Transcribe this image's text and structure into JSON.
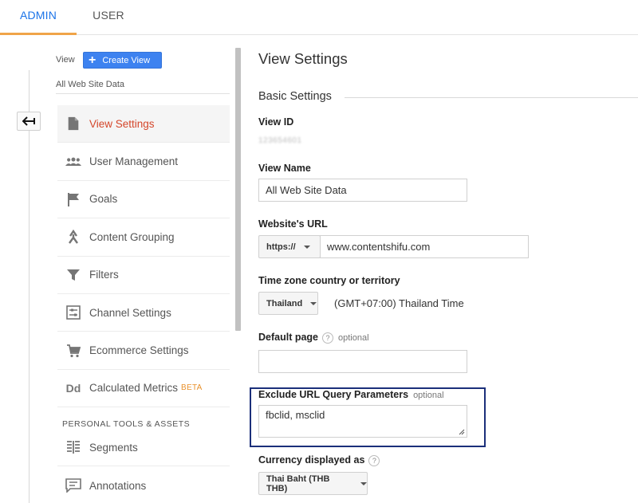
{
  "tabs": {
    "admin": "ADMIN",
    "user": "USER"
  },
  "sidebar": {
    "view_label": "View",
    "create_view": "Create View",
    "all_data": "All Web Site Data",
    "items": [
      {
        "label": "View Settings",
        "icon": "document-icon"
      },
      {
        "label": "User Management",
        "icon": "people-icon"
      },
      {
        "label": "Goals",
        "icon": "flag-icon"
      },
      {
        "label": "Content Grouping",
        "icon": "content-grouping-icon"
      },
      {
        "label": "Filters",
        "icon": "filter-icon"
      },
      {
        "label": "Channel Settings",
        "icon": "channel-settings-icon"
      },
      {
        "label": "Ecommerce Settings",
        "icon": "cart-icon"
      },
      {
        "label": "Calculated Metrics",
        "icon": "dd-icon",
        "badge": "BETA"
      }
    ],
    "section_title": "PERSONAL TOOLS & ASSETS",
    "personal_items": [
      {
        "label": "Segments",
        "icon": "segments-icon"
      },
      {
        "label": "Annotations",
        "icon": "annotation-icon"
      }
    ]
  },
  "main": {
    "title": "View Settings",
    "section": "Basic Settings",
    "view_id_label": "View ID",
    "view_id_value": "123654601",
    "view_name_label": "View Name",
    "view_name_value": "All Web Site Data",
    "website_url_label": "Website's URL",
    "protocol": "https://",
    "website_url_value": "www.contentshifu.com",
    "timezone_label": "Time zone country or territory",
    "timezone_country": "Thailand",
    "timezone_value": "(GMT+07:00) Thailand Time",
    "default_page_label": "Default page",
    "default_page_value": "",
    "optional": "optional",
    "help_glyph": "?",
    "exclude_label": "Exclude URL Query Parameters",
    "exclude_value": "fbclid, msclid",
    "currency_label": "Currency displayed as",
    "currency_value": "Thai Baht (THB THB)"
  },
  "colors": {
    "accent_blue": "#1a73e8",
    "tab_underline": "#f0a449",
    "active_nav": "#d4462a",
    "beta": "#e8902a",
    "highlight_border": "#1b2f7a",
    "create_button": "#3d82f0"
  }
}
